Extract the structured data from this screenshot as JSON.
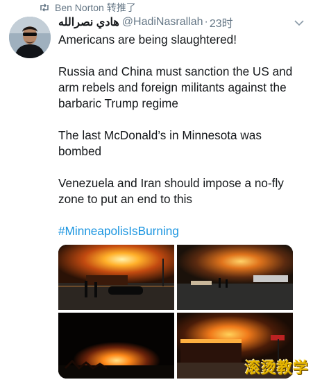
{
  "retweet": {
    "text": "Ben Norton 转推了"
  },
  "tweet": {
    "display_name": "هادي نصرالله",
    "handle": "@HadiNasrallah",
    "separator": "·",
    "time": "23时",
    "paragraphs": [
      "Americans are being slaughtered!",
      "Russia and China must sanction the US and arm rebels and foreign militants against the barbaric Trump regime",
      "The last McDonald’s in Minnesota was bombed",
      "Venezuela and Iran should impose a no-fly zone to put an end to this"
    ],
    "hashtag": "#MinneapolisIsBurning"
  },
  "media": {
    "photos": [
      {
        "name": "fire-photo-1"
      },
      {
        "name": "fire-photo-2"
      },
      {
        "name": "fire-photo-3"
      },
      {
        "name": "fire-photo-4"
      }
    ]
  },
  "watermark": {
    "text": "滚烫教学"
  },
  "colors": {
    "link": "#1b95e0",
    "muted": "#657786",
    "text": "#14171a"
  },
  "icons": {
    "retweet": "retweet-icon",
    "menu": "chevron-down-icon"
  }
}
